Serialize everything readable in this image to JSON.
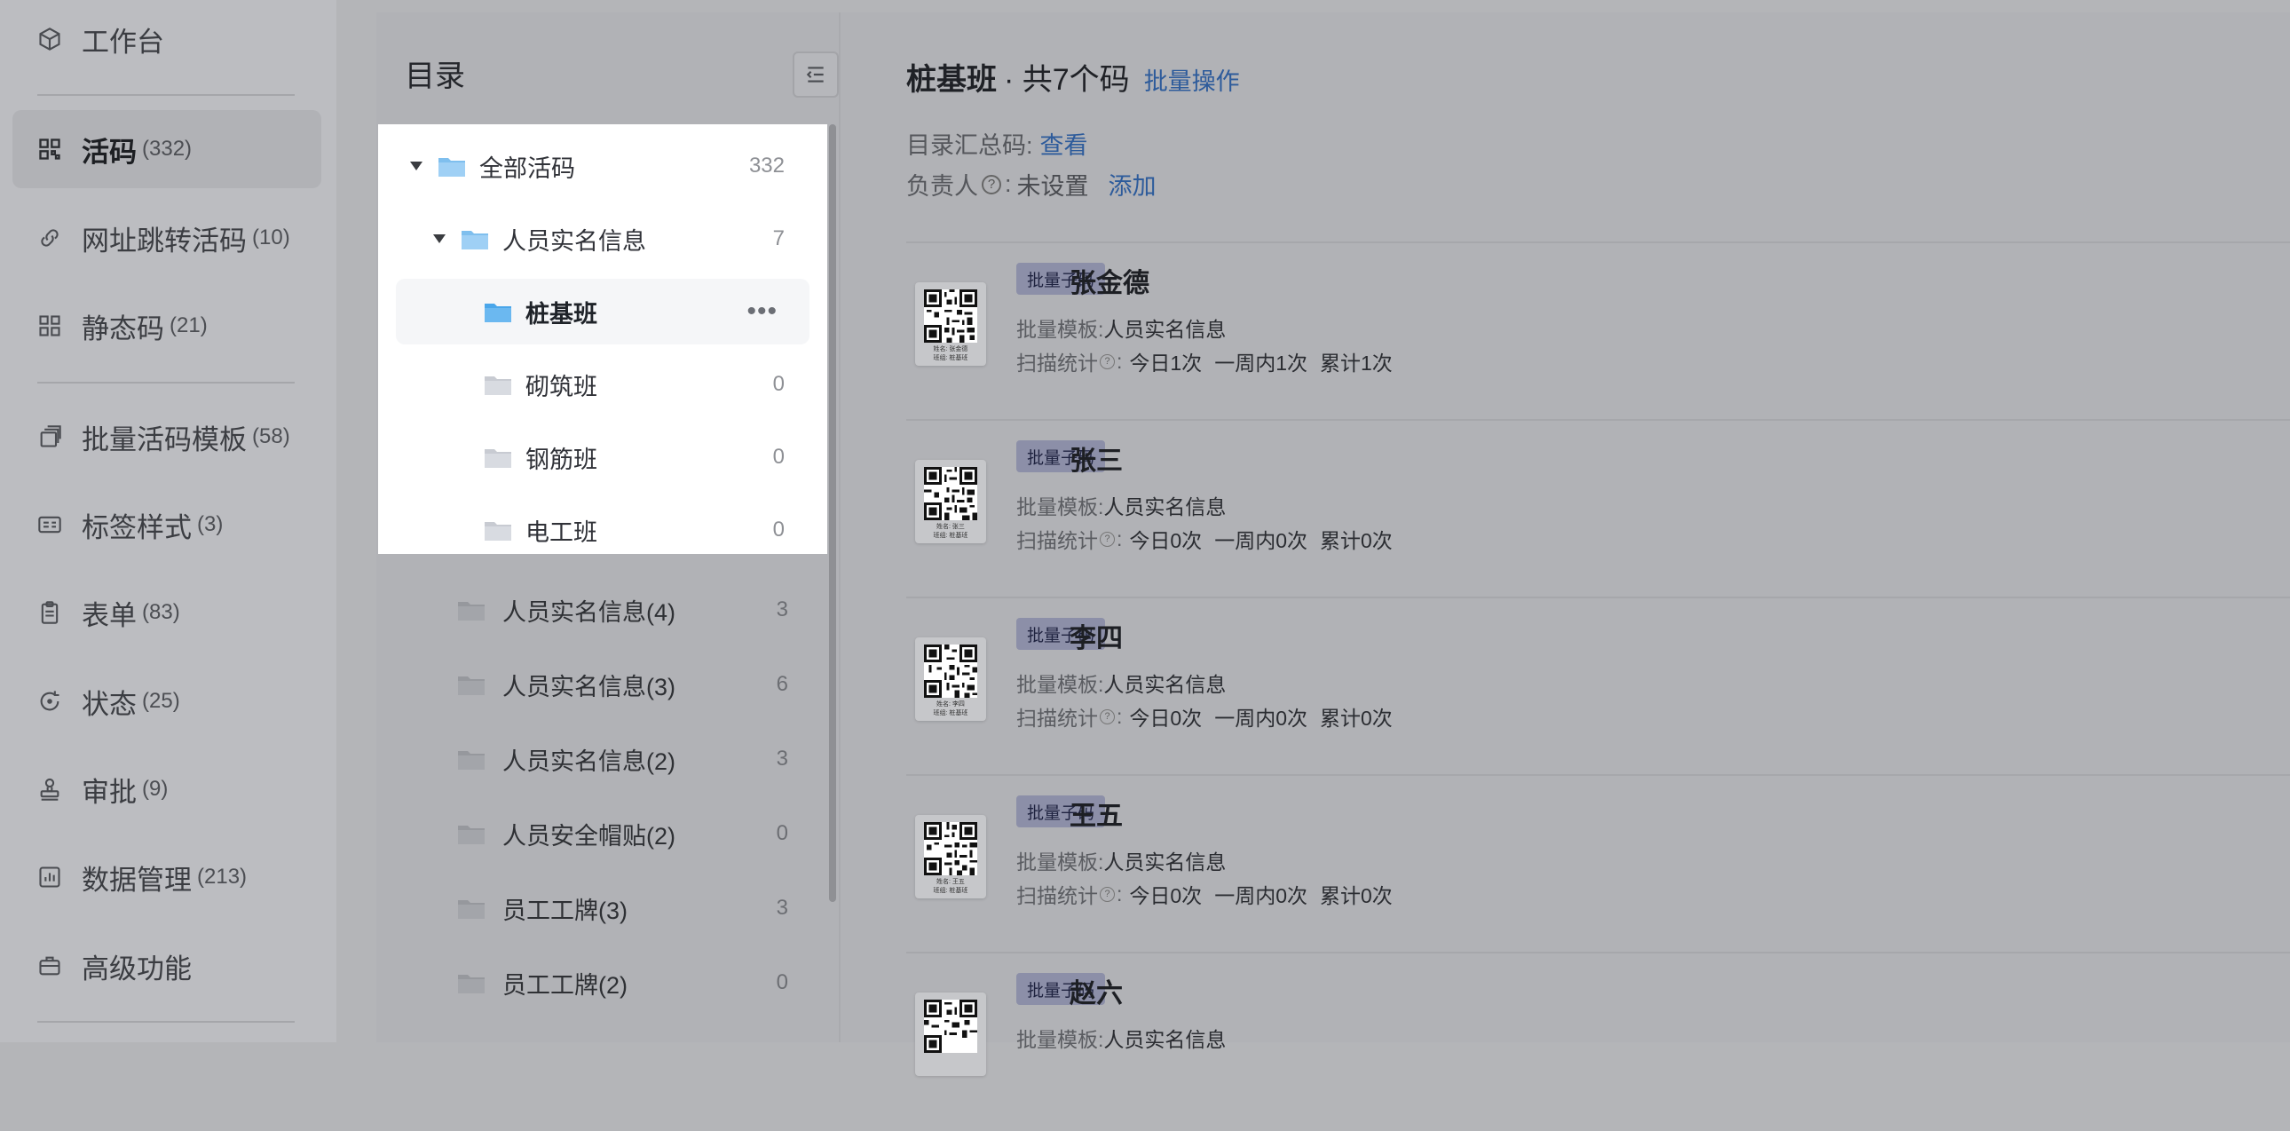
{
  "nav": {
    "items": [
      {
        "label": "工作台",
        "count": "",
        "icon": "cube-icon"
      },
      {
        "label": "活码",
        "count": "(332)",
        "icon": "qrcode-icon",
        "active": true
      },
      {
        "label": "网址跳转活码",
        "count": "(10)",
        "icon": "link-icon"
      },
      {
        "label": "静态码",
        "count": "(21)",
        "icon": "static-qrcode-icon"
      },
      {
        "label": "批量活码模板",
        "count": "(58)",
        "icon": "template-stack-icon"
      },
      {
        "label": "标签样式",
        "count": "(3)",
        "icon": "label-card-icon"
      },
      {
        "label": "表单",
        "count": "(83)",
        "icon": "clipboard-icon"
      },
      {
        "label": "状态",
        "count": "(25)",
        "icon": "status-refresh-icon"
      },
      {
        "label": "审批",
        "count": "(9)",
        "icon": "stamp-icon"
      },
      {
        "label": "数据管理",
        "count": "(213)",
        "icon": "bar-chart-icon"
      },
      {
        "label": "高级功能",
        "count": "",
        "icon": "briefcase-icon"
      }
    ]
  },
  "catalog": {
    "title": "目录",
    "tree": [
      {
        "label": "全部活码",
        "count": "332"
      },
      {
        "label": "人员实名信息",
        "count": "7"
      },
      {
        "label": "桩基班",
        "count": ""
      },
      {
        "label": "砌筑班",
        "count": "0"
      },
      {
        "label": "钢筋班",
        "count": "0"
      },
      {
        "label": "电工班",
        "count": "0"
      },
      {
        "label": "人员实名信息(4)",
        "count": "3"
      },
      {
        "label": "人员实名信息(3)",
        "count": "6"
      },
      {
        "label": "人员实名信息(2)",
        "count": "3"
      },
      {
        "label": "人员安全帽贴(2)",
        "count": "0"
      },
      {
        "label": "员工工牌(3)",
        "count": "3"
      },
      {
        "label": "员工工牌(2)",
        "count": "0"
      }
    ],
    "more": "•••"
  },
  "main": {
    "title": "桩基班",
    "subtitle": "· 共7个码",
    "batch_link": "批量操作",
    "summary_label": "目录汇总码:",
    "summary_link": "查看",
    "owner_label": "负责人",
    "owner_help": "?",
    "owner_colon": ":",
    "owner_value": "未设置",
    "owner_link": "添加",
    "cards": [
      {
        "badge": "批量子码",
        "name": "张金德",
        "template_label": "批量模板:",
        "template": "人员实名信息",
        "stats_label": "扫描统计",
        "today": "今日1次",
        "week": "一周内1次",
        "total": "累计1次",
        "qr_cap1": "姓名: 张金德",
        "qr_cap2": "班组: 桩基班"
      },
      {
        "badge": "批量子码",
        "name": "张三",
        "template_label": "批量模板:",
        "template": "人员实名信息",
        "stats_label": "扫描统计",
        "today": "今日0次",
        "week": "一周内0次",
        "total": "累计0次",
        "qr_cap1": "姓名: 张三",
        "qr_cap2": "班组: 桩基班"
      },
      {
        "badge": "批量子码",
        "name": "李四",
        "template_label": "批量模板:",
        "template": "人员实名信息",
        "stats_label": "扫描统计",
        "today": "今日0次",
        "week": "一周内0次",
        "total": "累计0次",
        "qr_cap1": "姓名: 李四",
        "qr_cap2": "班组: 桩基班"
      },
      {
        "badge": "批量子码",
        "name": "王五",
        "template_label": "批量模板:",
        "template": "人员实名信息",
        "stats_label": "扫描统计",
        "today": "今日0次",
        "week": "一周内0次",
        "total": "累计0次",
        "qr_cap1": "姓名: 王五",
        "qr_cap2": "班组: 桩基班"
      },
      {
        "badge": "批量子码",
        "name": "赵六",
        "template_label": "批量模板:",
        "template": "人员实名信息",
        "stats_label": "扫描统计",
        "today": "",
        "week": "",
        "total": "",
        "qr_cap1": "",
        "qr_cap2": ""
      }
    ]
  }
}
